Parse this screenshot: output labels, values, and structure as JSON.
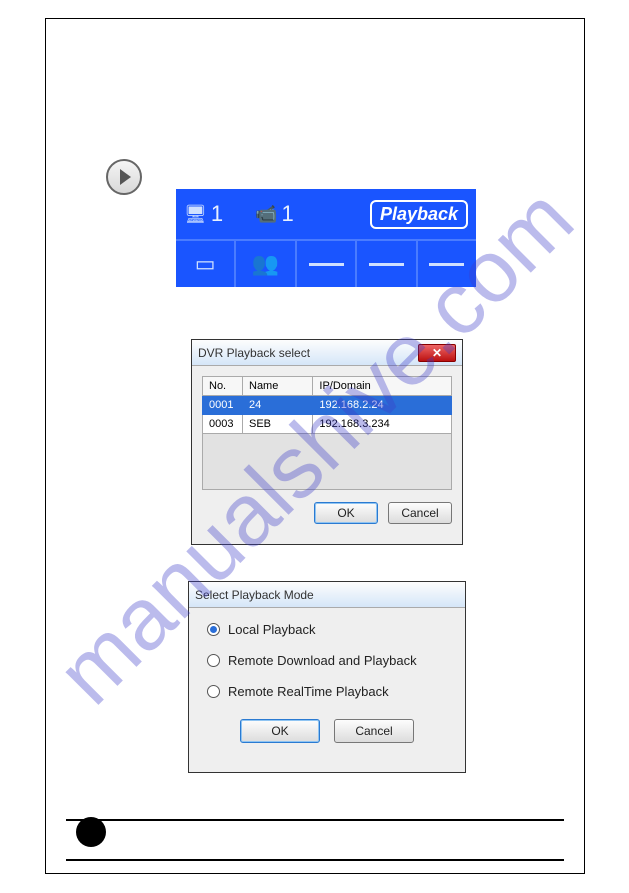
{
  "watermark": "manualshive.com",
  "banner": {
    "count1": "1",
    "count2": "1",
    "playback_label": "Playback"
  },
  "dvr_dialog": {
    "title": "DVR Playback select",
    "columns": {
      "no": "No.",
      "name": "Name",
      "ip": "IP/Domain"
    },
    "rows": [
      {
        "no": "0001",
        "name": "24",
        "ip": "192.168.2.24",
        "selected": true
      },
      {
        "no": "0003",
        "name": "SEB",
        "ip": "192.168.3.234",
        "selected": false
      }
    ],
    "ok": "OK",
    "cancel": "Cancel"
  },
  "mode_dialog": {
    "title": "Select Playback Mode",
    "options": [
      {
        "label": "Local Playback",
        "selected": true
      },
      {
        "label": "Remote Download and Playback",
        "selected": false
      },
      {
        "label": "Remote RealTime Playback",
        "selected": false
      }
    ],
    "ok": "OK",
    "cancel": "Cancel"
  }
}
